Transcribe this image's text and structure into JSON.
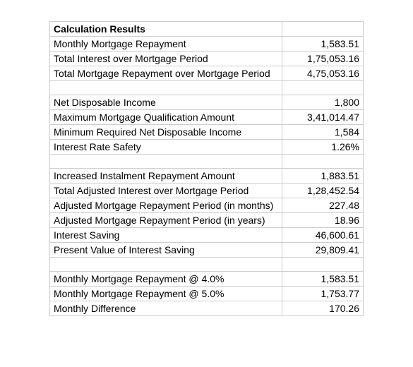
{
  "title": "Calculation Results",
  "sections": [
    {
      "rows": [
        {
          "label": "Monthly Mortgage Repayment",
          "value": "1,583.51"
        },
        {
          "label": "Total Interest over Mortgage Period",
          "value": "1,75,053.16"
        },
        {
          "label": "Total Mortgage Repayment over Mortgage Period",
          "value": "4,75,053.16"
        }
      ]
    },
    {
      "rows": [
        {
          "label": "Net Disposable Income",
          "value": "1,800"
        },
        {
          "label": "Maximum Mortgage Qualification Amount",
          "value": "3,41,014.47"
        },
        {
          "label": "Minimum Required Net Disposable Income",
          "value": "1,584"
        },
        {
          "label": "Interest Rate Safety",
          "value": "1.26%"
        }
      ]
    },
    {
      "rows": [
        {
          "label": "Increased Instalment Repayment Amount",
          "value": "1,883.51"
        },
        {
          "label": "Total Adjusted Interest over Mortgage Period",
          "value": "1,28,452.54"
        },
        {
          "label": "Adjusted Mortgage Repayment Period (in months)",
          "value": "227.48"
        },
        {
          "label": "Adjusted Mortgage Repayment Period (in years)",
          "value": "18.96"
        },
        {
          "label": "Interest Saving",
          "value": "46,600.61"
        },
        {
          "label": "Present Value of Interest Saving",
          "value": "29,809.41"
        }
      ]
    },
    {
      "rows": [
        {
          "label": "Monthly Mortgage Repayment @ 4.0%",
          "value": "1,583.51"
        },
        {
          "label": "Monthly Mortgage Repayment @ 5.0%",
          "value": "1,753.77"
        },
        {
          "label": "Monthly Difference",
          "value": "170.26"
        }
      ]
    }
  ]
}
